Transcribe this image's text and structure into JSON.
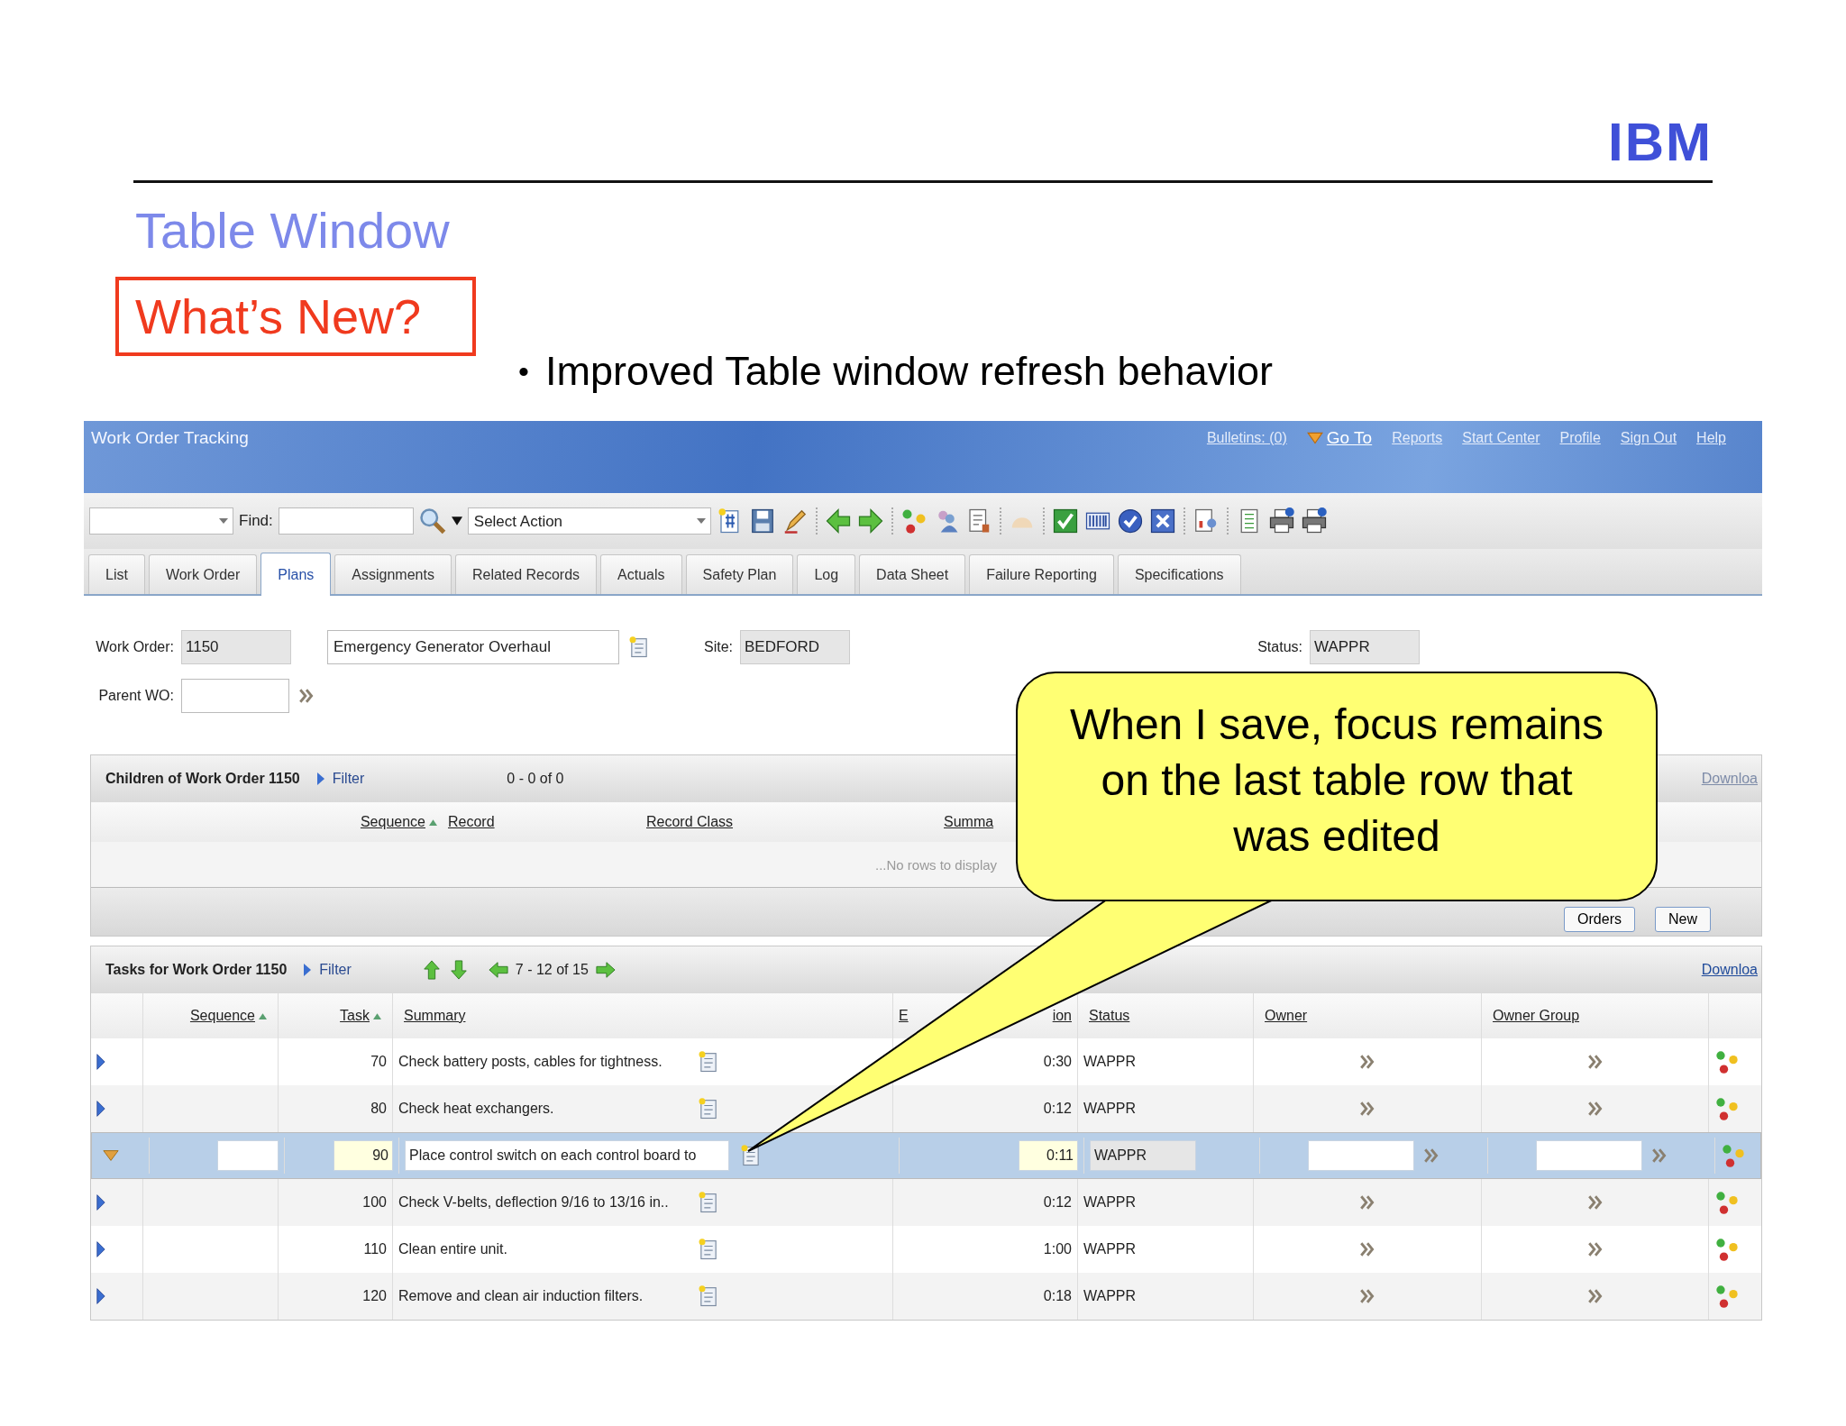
{
  "slide": {
    "logo": "IBM",
    "title": "Table Window",
    "highlight": "What’s New?",
    "bullet": {
      "marker": "•",
      "text": "Improved Table window refresh behavior"
    }
  },
  "app": {
    "title": "Work Order Tracking",
    "nav_links": [
      "Bulletins: (0)",
      "Go To",
      "Reports",
      "Start Center",
      "Profile",
      "Sign Out",
      "Help"
    ],
    "toolbar": {
      "find_label": "Find:",
      "action_select": "Select Action"
    },
    "tabs": [
      {
        "label": "List",
        "selected": false
      },
      {
        "label": "Work Order",
        "selected": false
      },
      {
        "label": "Plans",
        "selected": true
      },
      {
        "label": "Assignments",
        "selected": false
      },
      {
        "label": "Related Records",
        "selected": false
      },
      {
        "label": "Actuals",
        "selected": false
      },
      {
        "label": "Safety Plan",
        "selected": false
      },
      {
        "label": "Log",
        "selected": false
      },
      {
        "label": "Data Sheet",
        "selected": false
      },
      {
        "label": "Failure Reporting",
        "selected": false
      },
      {
        "label": "Specifications",
        "selected": false
      }
    ],
    "form": {
      "work_order_label": "Work Order:",
      "work_order": "1150",
      "description": "Emergency Generator Overhaul",
      "site_label": "Site:",
      "site": "BEDFORD",
      "status_label": "Status:",
      "status": "WAPPR",
      "parent_label": "Parent WO:"
    },
    "children": {
      "title": "Children of Work Order 1150",
      "filter": "Filter",
      "paging": "0 - 0 of 0",
      "download": "Downloa",
      "columns": [
        {
          "label": "Sequence",
          "sorted": true
        },
        {
          "label": "Record",
          "sorted": false
        },
        {
          "label": "Record Class",
          "sorted": false
        },
        {
          "label": "Summa",
          "sorted": false
        }
      ],
      "empty_message": "...No rows to display",
      "buttons": [
        "Orders",
        "New"
      ]
    },
    "tasks": {
      "title": "Tasks for Work Order 1150",
      "filter": "Filter",
      "paging": "7 - 12 of 15",
      "download": "Downloa",
      "columns": [
        {
          "label": "Sequence",
          "sorted": true
        },
        {
          "label": "Task",
          "sorted": true
        },
        {
          "label": "Summary",
          "sorted": false
        },
        {
          "label": "E",
          "tail": "ion",
          "sorted": false
        },
        {
          "label": "Status",
          "sorted": false
        },
        {
          "label": "Owner",
          "sorted": false
        },
        {
          "label": "Owner Group",
          "sorted": false
        }
      ],
      "rows": [
        {
          "task": "70",
          "summary": "Check battery posts, cables for tightness.",
          "duration": "0:30",
          "status": "WAPPR",
          "selected": false,
          "expanded": false
        },
        {
          "task": "80",
          "summary": "Check heat exchangers.",
          "duration": "0:12",
          "status": "WAPPR",
          "selected": false,
          "expanded": false
        },
        {
          "task": "90",
          "summary": "Place control switch on each control board to",
          "duration": "0:11",
          "status": "WAPPR",
          "selected": true,
          "expanded": true
        },
        {
          "task": "100",
          "summary": "Check V-belts, deflection 9/16 to 13/16 in..",
          "duration": "0:12",
          "status": "WAPPR",
          "selected": false,
          "expanded": false
        },
        {
          "task": "110",
          "summary": "Clean entire unit.",
          "duration": "1:00",
          "status": "WAPPR",
          "selected": false,
          "expanded": false
        },
        {
          "task": "120",
          "summary": "Remove and clean air induction filters.",
          "duration": "0:18",
          "status": "WAPPR",
          "selected": false,
          "expanded": false
        }
      ]
    }
  },
  "callout": {
    "text": "When I save, focus remains on the last table row that was edited"
  }
}
